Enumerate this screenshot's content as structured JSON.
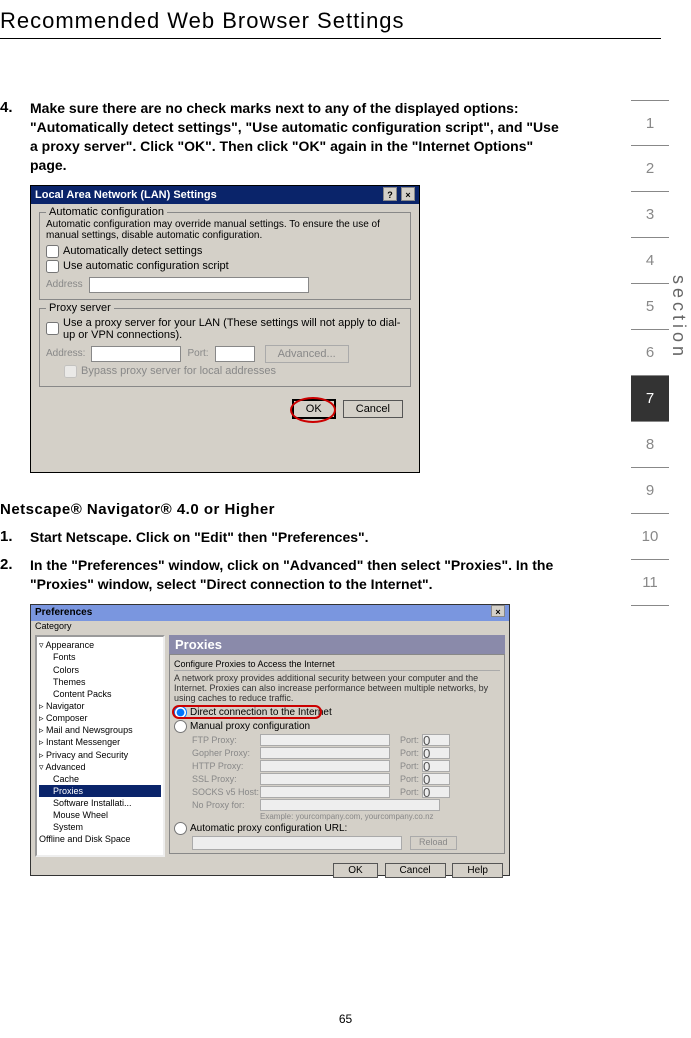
{
  "page_title": "Recommended Web Browser Settings",
  "page_number": "65",
  "section_word": "section",
  "side_tabs": [
    "1",
    "2",
    "3",
    "4",
    "5",
    "6",
    "7",
    "8",
    "9",
    "10",
    "11"
  ],
  "active_tab_index": 6,
  "step4": {
    "num": "4.",
    "text": "Make sure there are no check marks next to any of the displayed options: \"Automatically detect settings\", \"Use automatic configuration script\", and \"Use a proxy server\". Click \"OK\". Then click \"OK\" again in the \"Internet Options\" page."
  },
  "lan_dialog": {
    "title": "Local Area Network (LAN) Settings",
    "help_btn": "?",
    "close_btn": "×",
    "group1_label": "Automatic configuration",
    "group1_note": "Automatic configuration may override manual settings. To ensure the use of manual settings, disable automatic configuration.",
    "chk1": "Automatically detect settings",
    "chk2": "Use automatic configuration script",
    "address_label": "Address",
    "group2_label": "Proxy server",
    "group2_note": "Use a proxy server for your LAN (These settings will not apply to dial-up or VPN connections).",
    "addr2_label": "Address:",
    "port_label": "Port:",
    "advanced_btn": "Advanced...",
    "bypass": "Bypass proxy server for local addresses",
    "ok_btn": "OK",
    "cancel_btn": "Cancel"
  },
  "netscape_heading": "Netscape® Navigator® 4.0 or Higher",
  "step1": {
    "num": "1.",
    "text": "Start Netscape. Click on \"Edit\" then \"Preferences\"."
  },
  "step2": {
    "num": "2.",
    "text": "In the \"Preferences\" window, click on \"Advanced\" then select \"Proxies\". In the \"Proxies\" window, select \"Direct connection to the Internet\"."
  },
  "pref_dialog": {
    "title": "Preferences",
    "close_btn": "×",
    "category_label": "Category",
    "tree": {
      "appearance": "Appearance",
      "fonts": "Fonts",
      "colors": "Colors",
      "themes": "Themes",
      "content_packs": "Content Packs",
      "navigator": "Navigator",
      "composer": "Composer",
      "mail": "Mail and Newsgroups",
      "im": "Instant Messenger",
      "privacy": "Privacy and Security",
      "advanced": "Advanced",
      "cache": "Cache",
      "proxies": "Proxies",
      "software": "Software Installati...",
      "mouse": "Mouse Wheel",
      "system": "System",
      "offline": "Offline and Disk Space"
    },
    "panel_title": "Proxies",
    "panel_sub": "Configure Proxies to Access the Internet",
    "panel_note": "A network proxy provides additional security between your computer and the Internet. Proxies can also increase performance between multiple networks, by using caches to reduce traffic.",
    "radio_direct": "Direct connection to the Internet",
    "radio_manual": "Manual proxy configuration",
    "ftp": "FTP Proxy:",
    "gopher": "Gopher Proxy:",
    "http": "HTTP Proxy:",
    "ssl": "SSL Proxy:",
    "socks": "SOCKS v5 Host:",
    "noproxy": "No Proxy for:",
    "port": "Port:",
    "port_val": "0",
    "example": "Example: yourcompany.com, yourcompany.co.nz",
    "radio_auto": "Automatic proxy configuration URL:",
    "reload_btn": "Reload",
    "ok_btn": "OK",
    "cancel_btn": "Cancel",
    "help_btn": "Help"
  }
}
